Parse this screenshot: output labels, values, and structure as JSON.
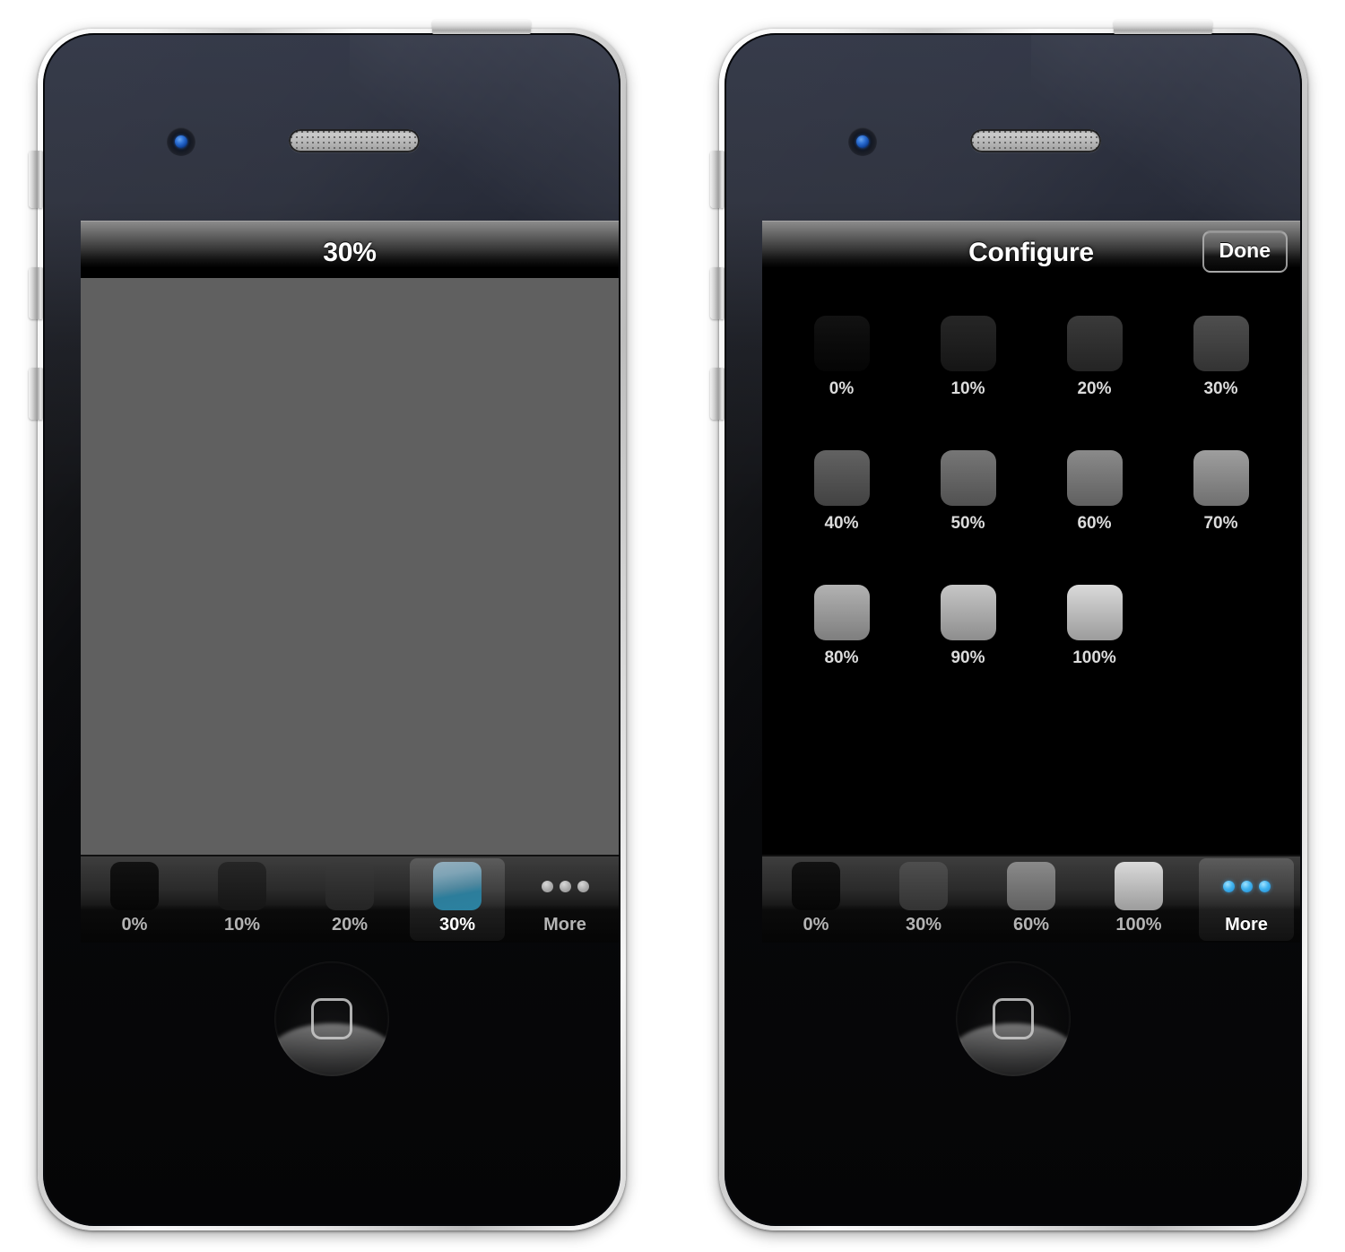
{
  "phones": [
    {
      "id": "phone-brightness-view",
      "nav": {
        "title": "30%",
        "button": null
      },
      "content": {
        "mode": "flat-gray",
        "fill_color": "#606060",
        "brightness_percent": 30
      },
      "tabbar": {
        "tabs": [
          {
            "label": "0%",
            "selected": false,
            "icon": "swatch-icon",
            "level": 0
          },
          {
            "label": "10%",
            "selected": false,
            "icon": "swatch-icon",
            "level": 10
          },
          {
            "label": "20%",
            "selected": false,
            "icon": "swatch-icon",
            "level": 20
          },
          {
            "label": "30%",
            "selected": true,
            "icon": "swatch-icon-selected",
            "level": 30
          },
          {
            "label": "More",
            "selected": false,
            "icon": "more-dots-icon",
            "dots": 3,
            "dots_color": "#aaaaaa"
          }
        ]
      }
    },
    {
      "id": "phone-configure-view",
      "nav": {
        "title": "Configure",
        "button": "Done"
      },
      "content": {
        "mode": "black-bg",
        "fill_color": "#000000"
      },
      "grid": {
        "rows": [
          [
            {
              "label": "0%",
              "level": 0
            },
            {
              "label": "10%",
              "level": 10
            },
            {
              "label": "20%",
              "level": 20
            },
            {
              "label": "30%",
              "level": 30
            }
          ],
          [
            {
              "label": "40%",
              "level": 40
            },
            {
              "label": "50%",
              "level": 50
            },
            {
              "label": "60%",
              "level": 60
            },
            {
              "label": "70%",
              "level": 70
            }
          ],
          [
            {
              "label": "80%",
              "level": 80
            },
            {
              "label": "90%",
              "level": 90
            },
            {
              "label": "100%",
              "level": 100
            },
            {
              "label": "",
              "level": null
            }
          ]
        ]
      },
      "tabbar": {
        "tabs": [
          {
            "label": "0%",
            "selected": false,
            "icon": "swatch-icon",
            "level": 0
          },
          {
            "label": "30%",
            "selected": false,
            "icon": "swatch-icon",
            "level": 30
          },
          {
            "label": "60%",
            "selected": false,
            "icon": "swatch-icon",
            "level": 60
          },
          {
            "label": "100%",
            "selected": false,
            "icon": "swatch-icon",
            "level": 100
          },
          {
            "label": "More",
            "selected": true,
            "icon": "more-dots-icon",
            "dots": 3,
            "dots_color": "#42b4f0"
          }
        ]
      }
    }
  ],
  "hardware": {
    "camera": "camera-icon",
    "speaker": "speaker-grille",
    "home_button": "home-button",
    "buttons": [
      "ring-switch",
      "volume-up",
      "volume-down",
      "power"
    ]
  }
}
